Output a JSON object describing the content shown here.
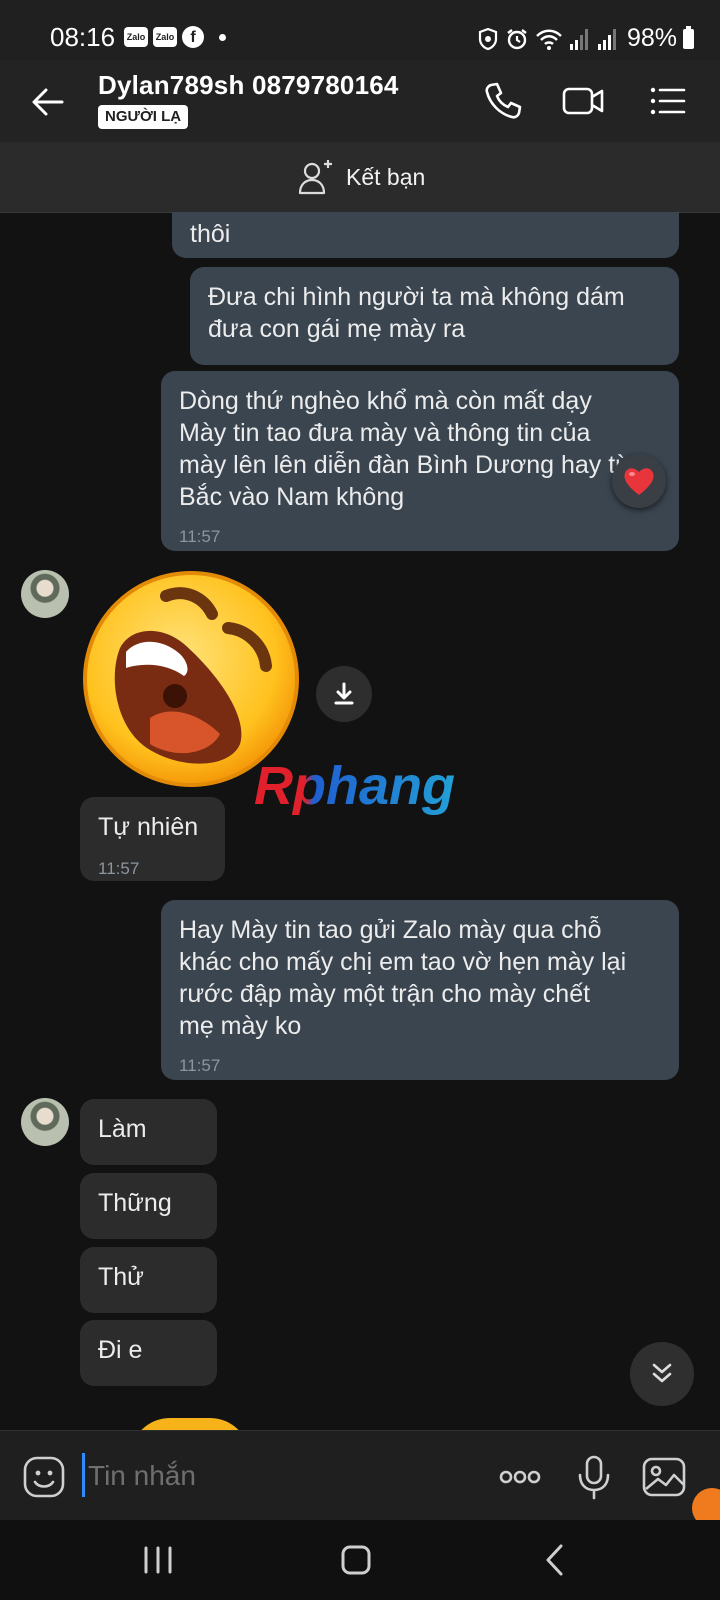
{
  "status_bar": {
    "time": "08:16",
    "app_icons": [
      "zalo-icon",
      "zalo-icon",
      "facebook-icon"
    ],
    "app_zalo_text": "Zalo",
    "app_fb_text": "f",
    "battery": "98%",
    "icons": [
      "vpn-icon",
      "alarm-icon",
      "wifi-icon",
      "signal-icon",
      "signal-icon",
      "battery-icon"
    ]
  },
  "header": {
    "contact_name": "Dylan789sh 0879780164",
    "badge": "NGƯỜI LẠ",
    "actions": [
      "phone-icon",
      "video-call-icon",
      "menu-icon"
    ]
  },
  "add_friend": {
    "label": "Kết bạn"
  },
  "messages": [
    {
      "side": "out",
      "text": "thôi",
      "time": ""
    },
    {
      "side": "out",
      "text": "Đưa chi hình người ta mà không dám\nđưa con gái mẹ mày ra",
      "time": ""
    },
    {
      "side": "out",
      "text": "Dòng thứ nghèo khổ mà còn mất dạy\nMày tin tao đưa mày và thông tin của\nmày lên lên diễn đàn Bình Dương hay từ\nBắc vào Nam không",
      "time": "11:57",
      "reaction": "heart-icon"
    },
    {
      "side": "in",
      "type": "sticker",
      "sticker": "laughing-emoji-sticker"
    },
    {
      "side": "in",
      "text": "Tự nhiên",
      "time": "11:57"
    },
    {
      "side": "out",
      "text": "Hay Mày tin tao gửi Zalo mày qua chỗ\nkhác cho mấy chị em tao vờ hẹn mày lại\nrước đập mày một trận cho mày chết\nmẹ mày ko",
      "time": "11:57"
    },
    {
      "side": "in",
      "text": "Làm",
      "time": ""
    },
    {
      "side": "in",
      "text": "Thững",
      "time": ""
    },
    {
      "side": "in",
      "text": "Thử",
      "time": ""
    },
    {
      "side": "in",
      "text": "Đi e",
      "time": ""
    }
  ],
  "watermark": "Rphang",
  "composer": {
    "placeholder": "Tin nhắn",
    "actions": [
      "emoji-icon",
      "more-icon",
      "microphone-icon",
      "image-icon"
    ]
  },
  "nav": [
    "recent-apps-icon",
    "home-icon",
    "back-icon"
  ],
  "colors": {
    "background": "#121212",
    "outgoing_bubble": "#3a4550",
    "incoming_bubble": "#2c2c2c",
    "header": "#232323",
    "accent": "#2f8cff"
  }
}
